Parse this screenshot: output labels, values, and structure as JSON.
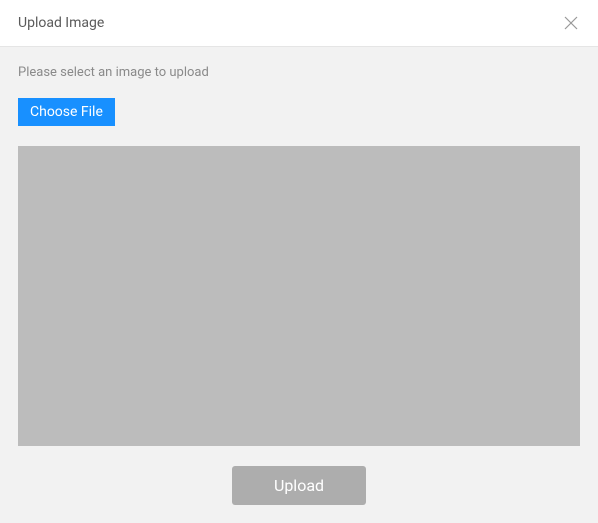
{
  "modal": {
    "title": "Upload Image",
    "instruction": "Please select an image to upload",
    "choose_file_label": "Choose File",
    "upload_label": "Upload"
  }
}
